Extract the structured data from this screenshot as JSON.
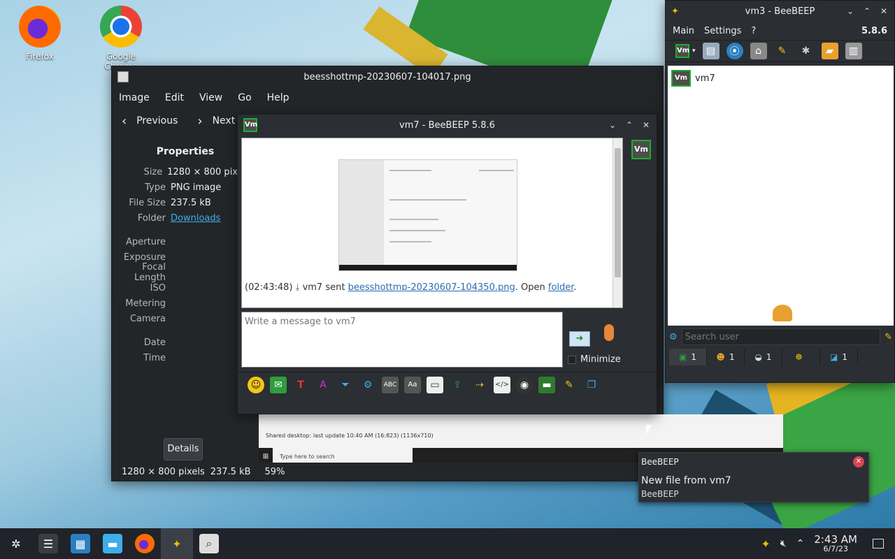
{
  "desktop": {
    "icons": [
      {
        "label": "Firefox",
        "icon": "firefox-icon"
      },
      {
        "label": "Google Chrome",
        "icon": "chrome-icon"
      }
    ]
  },
  "viewer": {
    "title": "beesshottmp-20230607-104017.png",
    "menu": [
      "Image",
      "Edit",
      "View",
      "Go",
      "Help"
    ],
    "nav": {
      "previous": "Previous",
      "next": "Next"
    },
    "properties": {
      "heading": "Properties",
      "rows": [
        {
          "key": "Size",
          "value": "1280 × 800 pix"
        },
        {
          "key": "Type",
          "value": "PNG image"
        },
        {
          "key": "File Size",
          "value": "237.5 kB"
        },
        {
          "key": "Folder",
          "value": "Downloads"
        }
      ],
      "exif": [
        "Aperture",
        "Exposure",
        "Focal Length",
        "ISO",
        "Metering",
        "Camera"
      ],
      "datetime": [
        "Date",
        "Time"
      ],
      "details_button": "Details"
    },
    "status": {
      "dimensions": "1280 × 800 pixels",
      "size": "237.5 kB",
      "zoom": "59%"
    },
    "shared_desktop_status": "Shared desktop: last update 10:40 AM (16:823) (1136x710)",
    "win10_search": "Type here to search"
  },
  "chat": {
    "title": "vm7 - BeeBEEP 5.8.6",
    "avatar": "Vm",
    "message": {
      "time": "(02:43:48)",
      "sender": "vm7 sent",
      "file": "beesshottmp-20230607-104350.png",
      "open_text": ". Open",
      "folder_link": "folder",
      "end": "."
    },
    "input_placeholder": "Write a message to vm7",
    "minimize_label": "Minimize"
  },
  "bee": {
    "title": "vm3 - BeeBEEP",
    "menu": [
      "Main",
      "Settings",
      "?"
    ],
    "version": "5.8.6",
    "users": [
      {
        "avatar": "Vm",
        "name": "vm7"
      }
    ],
    "search_placeholder": "Search user",
    "tabs": [
      {
        "icon": "users-icon",
        "count": "1"
      },
      {
        "icon": "group-icon",
        "count": "1"
      },
      {
        "icon": "chat-icon",
        "count": "1"
      },
      {
        "icon": "people-icon",
        "count": ""
      },
      {
        "icon": "file-icon",
        "count": "1"
      }
    ]
  },
  "notification": {
    "app": "BeeBEEP",
    "title": "New file from vm7",
    "body": "BeeBEEP"
  },
  "taskbar": {
    "time": "2:43 AM",
    "date": "6/7/23"
  },
  "colors": {
    "accent": "#3daee9",
    "vm_border": "#1fae2b",
    "close_red": "#da4453"
  }
}
